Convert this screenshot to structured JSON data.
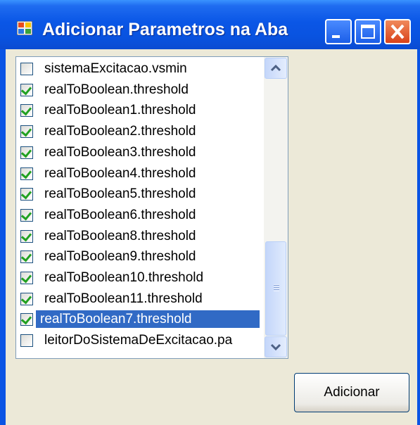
{
  "window": {
    "title": "Adicionar Parametros na Aba",
    "icon": "app-icon",
    "colors": {
      "titlebar": "#0a56e6",
      "client": "#ece9d8",
      "selection": "#316ac5",
      "checkmark": "#21a121"
    }
  },
  "list": {
    "items": [
      {
        "label": "sistemaExcitacao.vsmin",
        "checked": false,
        "selected": false
      },
      {
        "label": "realToBoolean.threshold",
        "checked": true,
        "selected": false
      },
      {
        "label": "realToBoolean1.threshold",
        "checked": true,
        "selected": false
      },
      {
        "label": "realToBoolean2.threshold",
        "checked": true,
        "selected": false
      },
      {
        "label": "realToBoolean3.threshold",
        "checked": true,
        "selected": false
      },
      {
        "label": "realToBoolean4.threshold",
        "checked": true,
        "selected": false
      },
      {
        "label": "realToBoolean5.threshold",
        "checked": true,
        "selected": false
      },
      {
        "label": "realToBoolean6.threshold",
        "checked": true,
        "selected": false
      },
      {
        "label": "realToBoolean8.threshold",
        "checked": true,
        "selected": false
      },
      {
        "label": "realToBoolean9.threshold",
        "checked": true,
        "selected": false
      },
      {
        "label": "realToBoolean10.threshold",
        "checked": true,
        "selected": false
      },
      {
        "label": "realToBoolean11.threshold",
        "checked": true,
        "selected": false
      },
      {
        "label": "realToBoolean7.threshold",
        "checked": true,
        "selected": true
      },
      {
        "label": "leitorDoSistemaDeExcitacao.pa",
        "checked": false,
        "selected": false
      }
    ]
  },
  "button": {
    "add_label": "Adicionar"
  }
}
